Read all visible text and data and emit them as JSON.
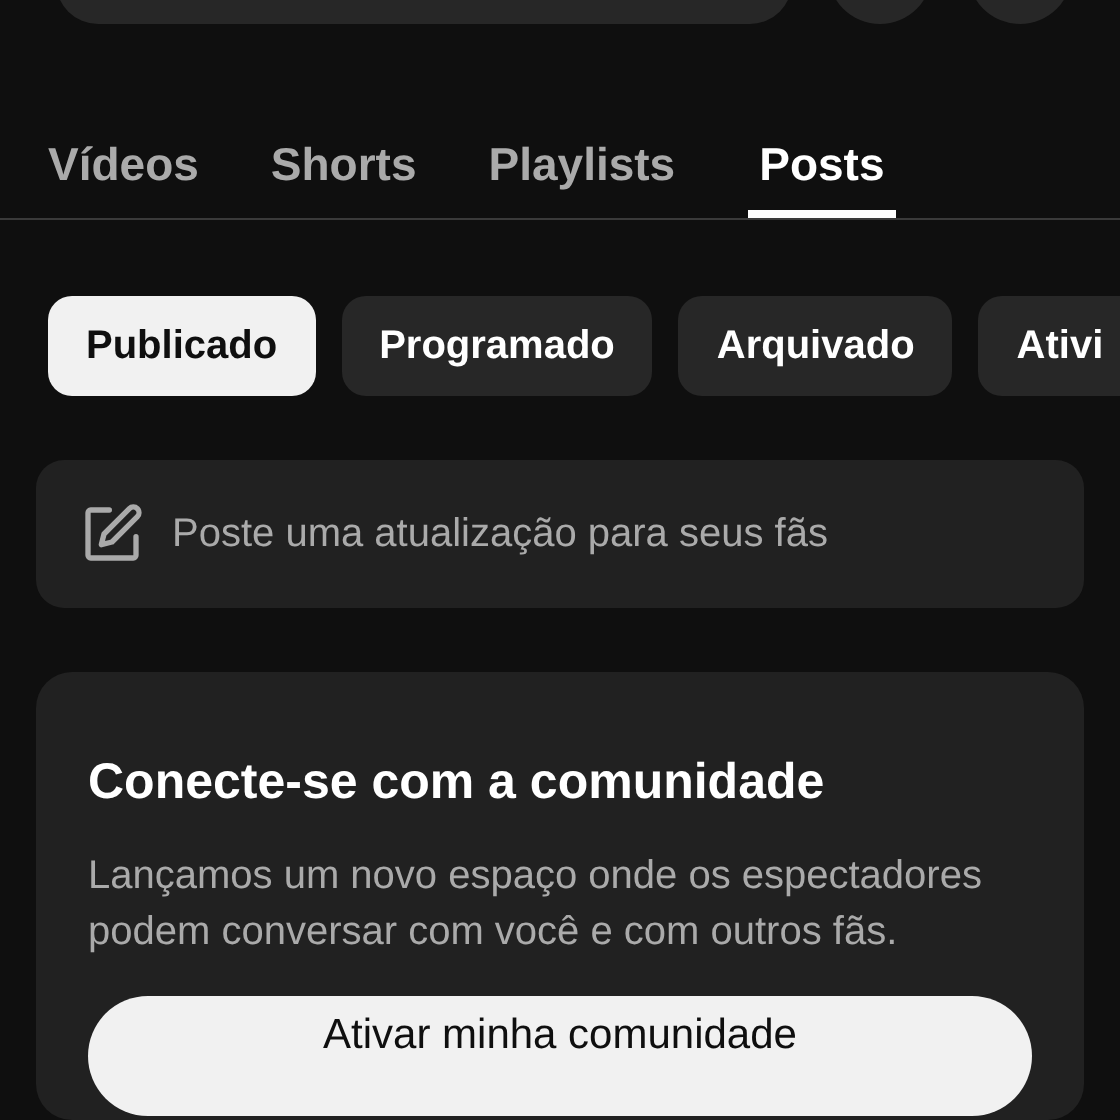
{
  "tabs": [
    {
      "label": "Vídeos",
      "selected": false
    },
    {
      "label": "Shorts",
      "selected": false
    },
    {
      "label": "Playlists",
      "selected": false
    },
    {
      "label": "Posts",
      "selected": true
    }
  ],
  "filters": [
    {
      "label": "Publicado",
      "selected": true
    },
    {
      "label": "Programado",
      "selected": false
    },
    {
      "label": "Arquivado",
      "selected": false
    },
    {
      "label": "Ativi",
      "selected": false
    }
  ],
  "composer": {
    "placeholder": "Poste uma atualização para seus fãs"
  },
  "community_card": {
    "title": "Conecte-se com a comunidade",
    "body": "Lançamos um novo espaço onde os espectadores podem conversar com você e com outros fãs.",
    "button": "Ativar minha comunidade"
  }
}
